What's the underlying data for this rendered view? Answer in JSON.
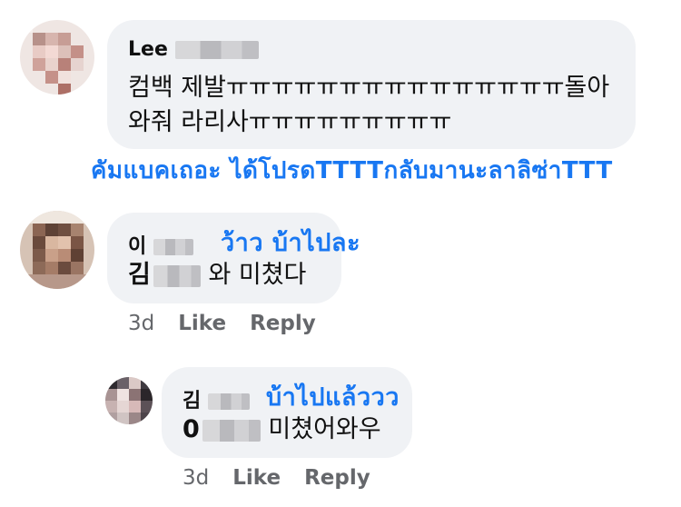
{
  "comments": [
    {
      "author_visible": "Lee",
      "lines": [
        "컴백 제발ㅠㅠㅠㅠㅠㅠㅠㅠㅠㅠㅠㅠㅠㅠㅠ돌아",
        "와줘 라리사ㅠㅠㅠㅠㅠㅠㅠㅠㅠ"
      ],
      "translation": "คัมแบคเถอะ ได้โปรดTTTTกลับมานะลาลิซ่าTTT"
    },
    {
      "author_visible": "이",
      "annotation": "ว้าว บ้าไปละ",
      "name_prefix": "김",
      "message": "와 미쳤다",
      "time": "3d",
      "like_label": "Like",
      "reply_label": "Reply"
    },
    {
      "author_visible": "김",
      "annotation": "บ้าไปแล้ววว",
      "name_prefix": "0",
      "message": "미쳤어와우",
      "time": "3d",
      "like_label": "Like",
      "reply_label": "Reply"
    }
  ]
}
